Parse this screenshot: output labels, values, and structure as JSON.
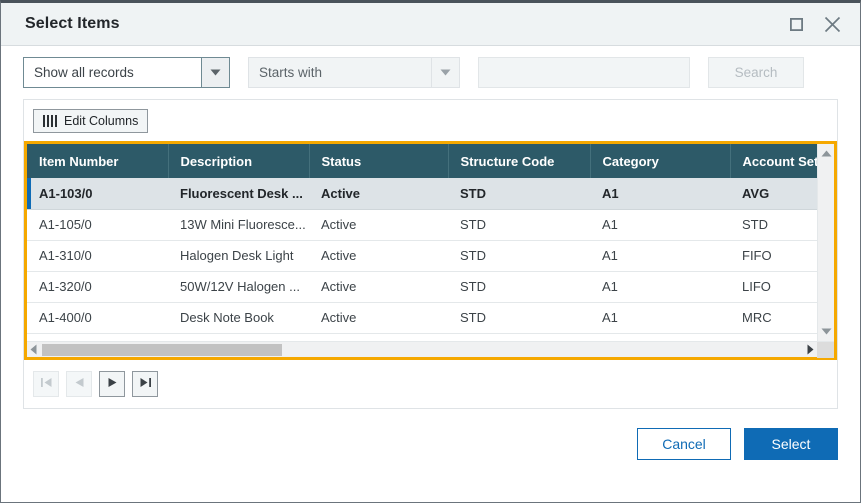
{
  "dialog": {
    "title": "Select Items",
    "window_controls": [
      {
        "name": "maximize",
        "icon": "square-icon"
      },
      {
        "name": "close",
        "icon": "close-icon"
      }
    ]
  },
  "filter_bar": {
    "record_filter": {
      "value": "Show all records",
      "icon": "chevron-down-icon"
    },
    "match_mode": {
      "value": "Starts with",
      "icon": "chevron-down-icon",
      "disabled": true
    },
    "search_field": {
      "value": "",
      "placeholder": ""
    },
    "search_button": {
      "label": "Search",
      "disabled": true
    }
  },
  "grid": {
    "edit_columns_label": "Edit Columns",
    "edit_columns_icon": "columns-icon",
    "columns": [
      "Item Number",
      "Description",
      "Status",
      "Structure Code",
      "Category",
      "Account Set Co"
    ],
    "rows": [
      {
        "selected": true,
        "cells": [
          "A1-103/0",
          "Fluorescent Desk ...",
          "Active",
          "STD",
          "A1",
          "AVG"
        ]
      },
      {
        "selected": false,
        "cells": [
          "A1-105/0",
          "13W Mini Fluoresce...",
          "Active",
          "STD",
          "A1",
          "STD"
        ]
      },
      {
        "selected": false,
        "cells": [
          "A1-310/0",
          "Halogen Desk Light",
          "Active",
          "STD",
          "A1",
          "FIFO"
        ]
      },
      {
        "selected": false,
        "cells": [
          "A1-320/0",
          "50W/12V Halogen ...",
          "Active",
          "STD",
          "A1",
          "LIFO"
        ]
      },
      {
        "selected": false,
        "cells": [
          "A1-400/0",
          "Desk Note Book",
          "Active",
          "STD",
          "A1",
          "MRC"
        ]
      }
    ],
    "highlight_color": "#f5a800",
    "header_color": "#2d5a68",
    "selected_row_accent": "#0f6bb5"
  },
  "pager": {
    "buttons": [
      {
        "name": "first-page",
        "icon": "first-page-icon",
        "disabled": true
      },
      {
        "name": "previous-page",
        "icon": "previous-page-icon",
        "disabled": true
      },
      {
        "name": "next-page",
        "icon": "next-page-icon",
        "disabled": false
      },
      {
        "name": "last-page",
        "icon": "last-page-icon",
        "disabled": false
      }
    ]
  },
  "footer": {
    "cancel_label": "Cancel",
    "select_label": "Select",
    "primary_color": "#0f6bb5"
  }
}
